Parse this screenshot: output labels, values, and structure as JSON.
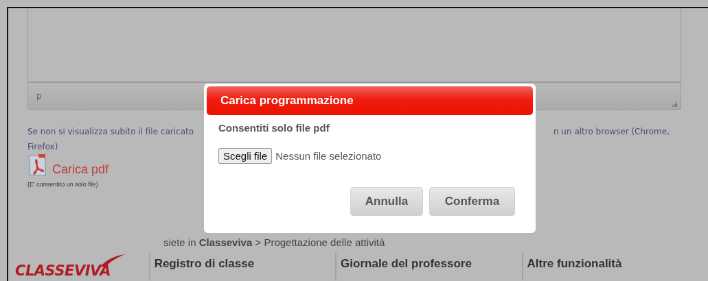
{
  "editor": {
    "path_label": "p"
  },
  "notice": {
    "start": "Se non si visualizza subito il file caricato",
    "end": "n un altro browser (Chrome,",
    "wrap": "Firefox)"
  },
  "upload": {
    "link": "Carica pdf",
    "hint": "(E' consentito un solo file)"
  },
  "breadcrumb": "siete in **Classeviva** > Progettazione delle attività",
  "logo": "CLASSEVIVA",
  "menu_columns": [
    "Registro di classe",
    "Giornale del professore",
    "Altre funzionalità"
  ],
  "dialog": {
    "title": "Carica programmazione",
    "message": "Consentiti solo file pdf",
    "file_button": "Scegli file",
    "file_status": "Nessun file selezionato",
    "buttons": [
      "Annulla",
      "Conferma"
    ]
  }
}
